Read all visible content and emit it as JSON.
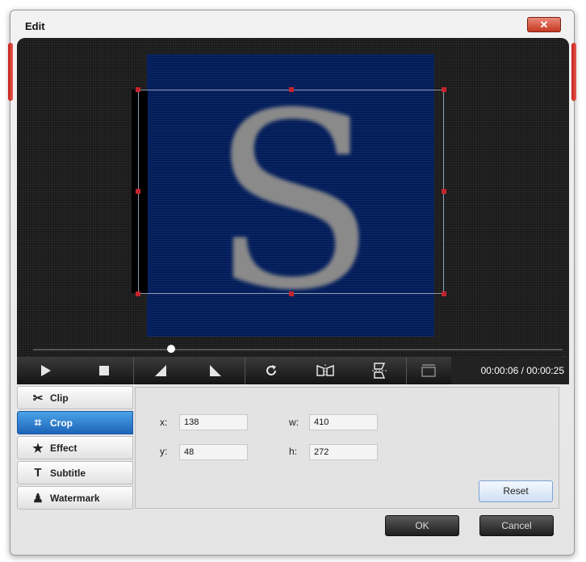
{
  "window": {
    "title": "Edit",
    "close_glyph": "✕"
  },
  "preview": {
    "letter": "S",
    "crop_frame": true
  },
  "player": {
    "time_display": "00:00:06 / 00:00:25",
    "buttons": [
      "play-icon",
      "stop-icon",
      "mark-in-icon",
      "mark-out-icon",
      "rotate-icon",
      "flip-horizontal-icon",
      "flip-vertical-icon",
      "snapshot-icon"
    ]
  },
  "tabs": [
    {
      "label": "Clip",
      "icon": "scissors-icon"
    },
    {
      "label": "Crop",
      "icon": "crop-icon",
      "active": true
    },
    {
      "label": "Effect",
      "icon": "star-icon"
    },
    {
      "label": "Subtitle",
      "icon": "text-icon"
    },
    {
      "label": "Watermark",
      "icon": "stamp-icon"
    }
  ],
  "crop": {
    "x_label": "x:",
    "x_value": "138",
    "y_label": "y:",
    "y_value": "48",
    "w_label": "w:",
    "w_value": "410",
    "h_label": "h:",
    "h_value": "272",
    "reset_label": "Reset"
  },
  "footer": {
    "ok_label": "OK",
    "cancel_label": "Cancel"
  },
  "colors": {
    "accent": "#1e63b8",
    "handle": "#c3242b",
    "video_bg": "#021c5a",
    "close": "#c63822"
  }
}
